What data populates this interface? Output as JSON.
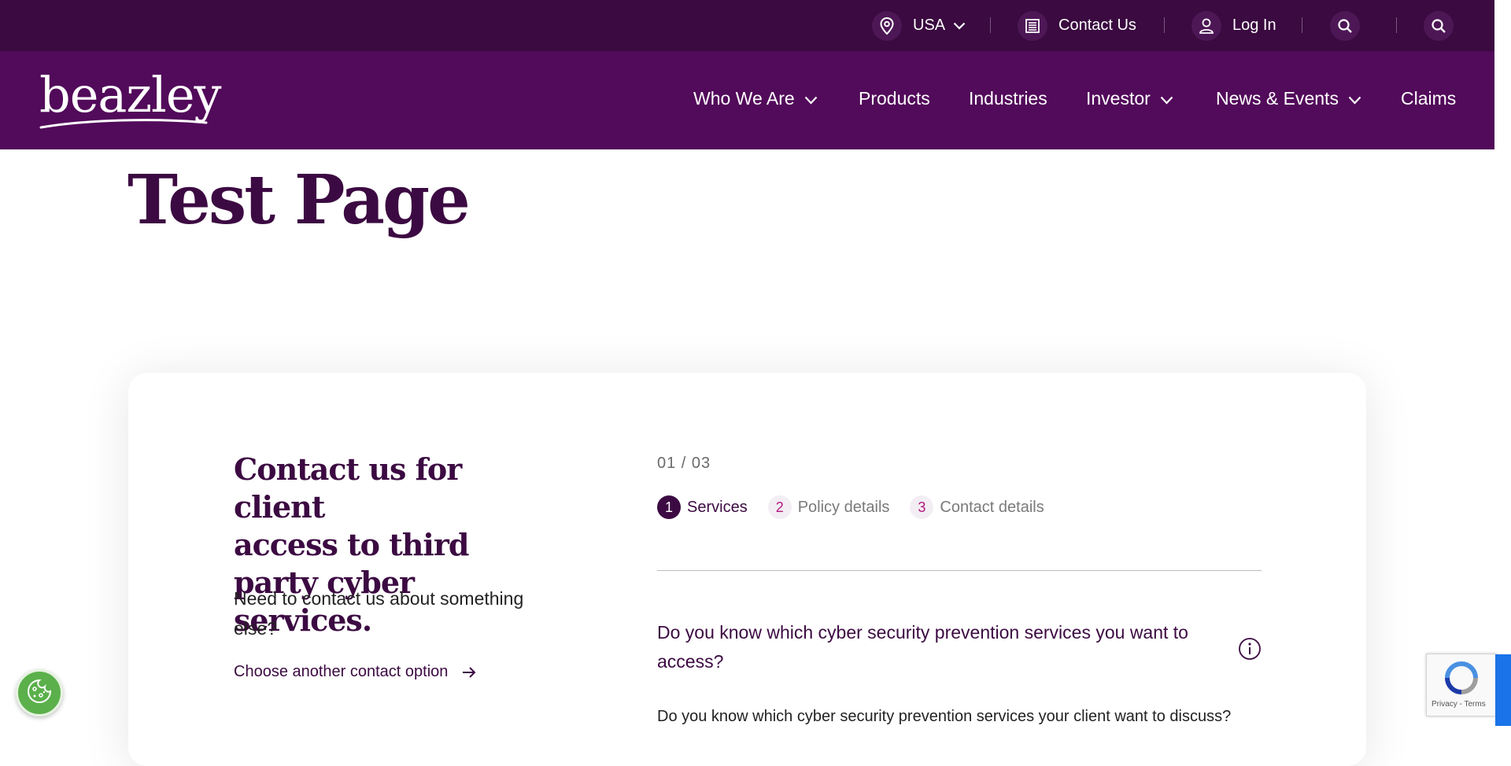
{
  "topbar": {
    "region": "USA",
    "contact": "Contact Us",
    "login": "Log In"
  },
  "brand": {
    "logo": "beazley"
  },
  "nav": {
    "items": [
      {
        "label": "Who We Are",
        "has_dropdown": true
      },
      {
        "label": "Products",
        "has_dropdown": false
      },
      {
        "label": "Industries",
        "has_dropdown": false
      },
      {
        "label": "Investor",
        "has_dropdown": true
      },
      {
        "label": "News & Events",
        "has_dropdown": true
      },
      {
        "label": "Claims",
        "has_dropdown": false
      }
    ]
  },
  "page": {
    "title": "Test Page"
  },
  "card": {
    "heading_lines": [
      "Contact us for client",
      "access to third",
      "party cyber services."
    ],
    "subtext": "Need to contact us about something else?",
    "link": "Choose another contact option"
  },
  "form": {
    "step_counter": "01 / 03",
    "steps": [
      {
        "num": "1",
        "label": "Services",
        "active": true
      },
      {
        "num": "2",
        "label": "Policy details",
        "active": false
      },
      {
        "num": "3",
        "label": "Contact details",
        "active": false
      }
    ],
    "question": "Do you know which cyber security prevention services you want to access?",
    "sub_question": "Do you know which cyber security prevention services your client want to discuss?"
  },
  "recaptcha": {
    "terms": "Privacy - Terms"
  },
  "colors": {
    "topbar": "#3a0a40",
    "nav": "#520a5a",
    "brand_text": "#3c0a42",
    "step_accent": "#b0197f",
    "cookie": "#5bb04b"
  },
  "icons": [
    "location-pin-icon",
    "chevron-down-icon",
    "contact-card-icon",
    "user-icon",
    "search-icon",
    "arrow-right-icon",
    "info-icon",
    "cookie-icon",
    "recaptcha-icon"
  ]
}
